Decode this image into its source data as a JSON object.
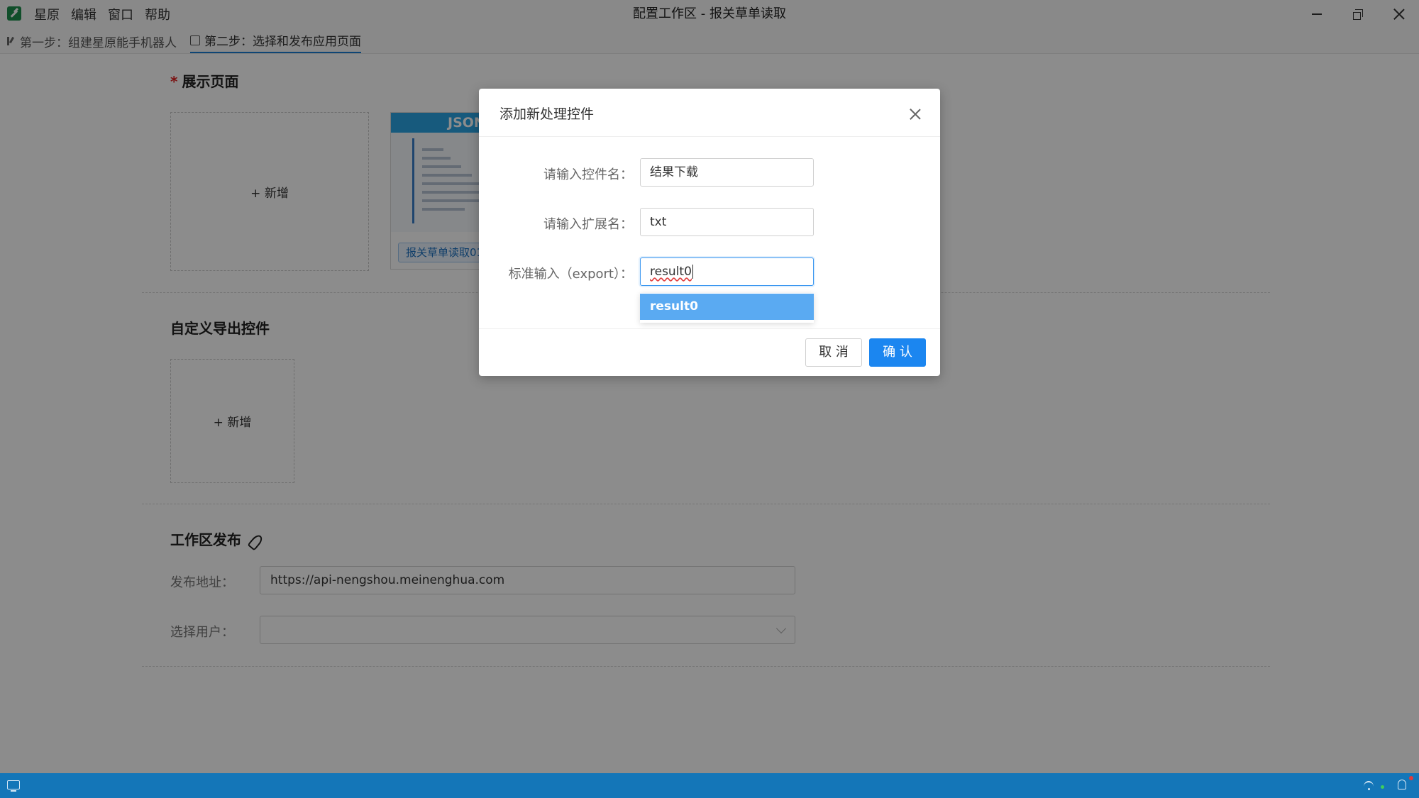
{
  "app": {
    "menu": [
      "星原",
      "编辑",
      "窗口",
      "帮助"
    ],
    "window_title": "配置工作区 - 报关草单读取"
  },
  "tabs": [
    {
      "label": "第一步：组建星原能手机器人",
      "icon": "branch-icon"
    },
    {
      "label": "第二步：选择和发布应用页面",
      "icon": "page-icon",
      "active": true
    }
  ],
  "display_section": {
    "title": "展示页面",
    "required": "*",
    "add_label": "+ 新增",
    "page_card": {
      "tag": "报关草单读取01",
      "thumbnail_header": "JSON"
    }
  },
  "export_section": {
    "title": "自定义导出控件",
    "add_label": "+ 新增"
  },
  "publish_section": {
    "title": "工作区发布",
    "address_label": "发布地址：",
    "address_value": "https://api-nengshou.meinenghua.com",
    "user_label": "选择用户：",
    "user_value": ""
  },
  "modal": {
    "title": "添加新处理控件",
    "fields": [
      {
        "label": "请输入控件名：",
        "value": "结果下载"
      },
      {
        "label": "请输入扩展名：",
        "value": "txt"
      },
      {
        "label": "标准输入（export）：",
        "value": "result0"
      }
    ],
    "suggestion": "result0",
    "cancel_label": "取 消",
    "ok_label": "确 认"
  },
  "colors": {
    "primary": "#1b86f0",
    "statusbar": "#1476b8",
    "suggest_highlight": "#5aaaf2",
    "required": "#e02020"
  }
}
